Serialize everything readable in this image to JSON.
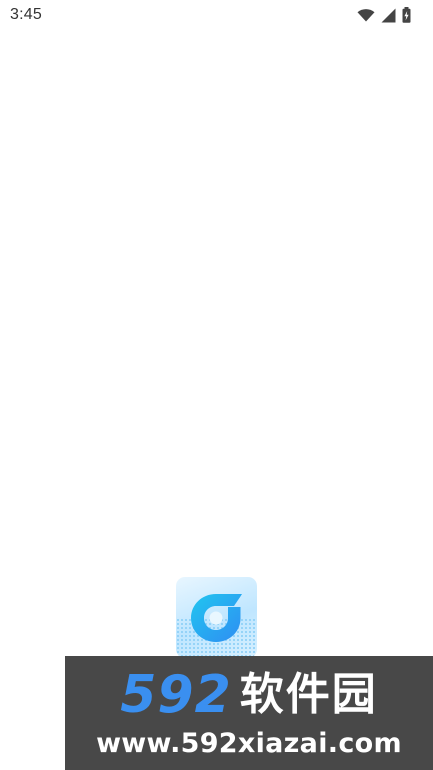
{
  "status_bar": {
    "time": "3:45",
    "icons": [
      "wifi-icon",
      "cellular-signal-icon",
      "battery-charging-icon"
    ]
  },
  "splash": {
    "app_icon": "app-logo-icon",
    "colors": {
      "logo_gradient_start": "#21c6f0",
      "logo_gradient_end": "#2f8df2"
    }
  },
  "watermark": {
    "brand_number": "592",
    "brand_text": "软件园",
    "url": "www.592xiazai.com",
    "colors": {
      "number": "#3a8ff0",
      "text": "#ffffff",
      "background": "#414141"
    }
  }
}
